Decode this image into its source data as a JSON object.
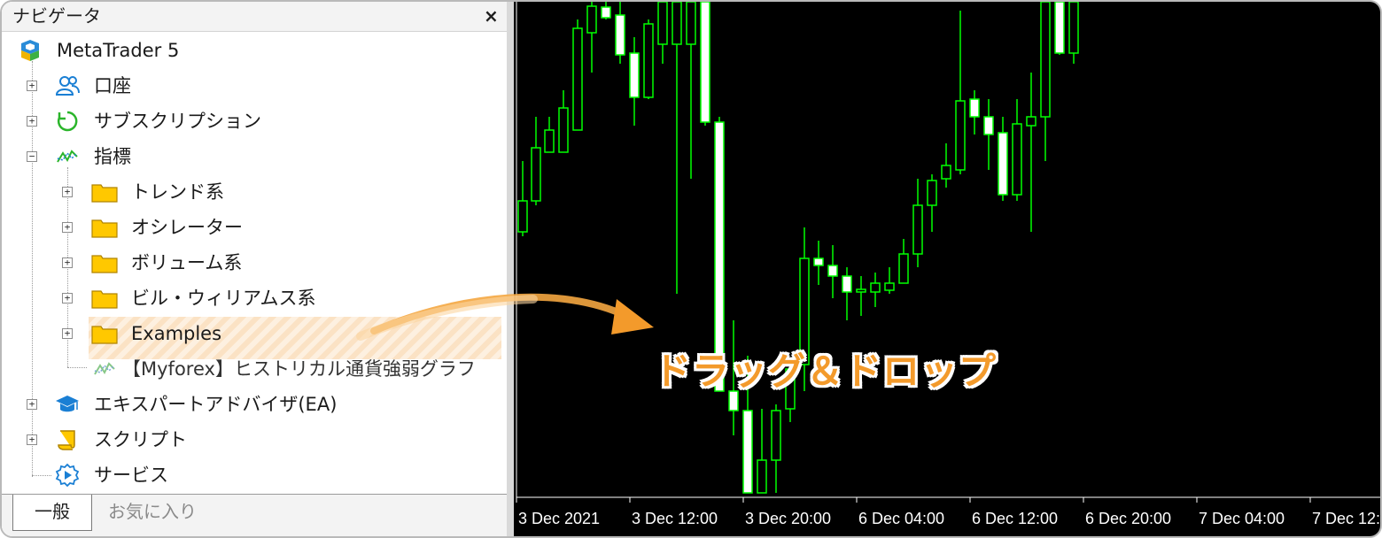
{
  "navigator": {
    "title": "ナビゲータ",
    "close_label": "×",
    "root": {
      "label": "MetaTrader 5",
      "icon": "metatrader-logo-icon"
    },
    "items": [
      {
        "label": "口座",
        "icon": "account-icon",
        "expander": "+"
      },
      {
        "label": "サブスクリプション",
        "icon": "subscription-icon",
        "expander": "+"
      },
      {
        "label": "指標",
        "icon": "indicator-icon",
        "expander": "−"
      },
      {
        "label": "トレンド系",
        "icon": "folder-icon",
        "expander": "+"
      },
      {
        "label": "オシレーター",
        "icon": "folder-icon",
        "expander": "+"
      },
      {
        "label": "ボリューム系",
        "icon": "folder-icon",
        "expander": "+"
      },
      {
        "label": "ビル・ウィリアムス系",
        "icon": "folder-icon",
        "expander": "+"
      },
      {
        "label": "Examples",
        "icon": "folder-icon",
        "expander": "+"
      },
      {
        "label": "【Myforex】ヒストリカル通貨強弱グラフ",
        "icon": "custom-indicator-icon",
        "selected": true
      },
      {
        "label": "エキスパートアドバイザ(EA)",
        "icon": "expert-advisor-icon",
        "expander": "+"
      },
      {
        "label": "スクリプト",
        "icon": "script-icon",
        "expander": "+"
      },
      {
        "label": "サービス",
        "icon": "service-icon"
      }
    ],
    "tabs": [
      {
        "label": "一般",
        "active": true
      },
      {
        "label": "お気に入り",
        "active": false
      }
    ]
  },
  "chart": {
    "background": "#000000",
    "candle_color": "#00ff00",
    "bull_fill": "#000000",
    "bear_fill": "#ffffff",
    "time_labels": [
      "3 Dec 2021",
      "3 Dec 12:00",
      "3 Dec 20:00",
      "6 Dec 04:00",
      "6 Dec 12:00",
      "6 Dec 20:00",
      "7 Dec 04:00",
      "7 Dec 12:00"
    ]
  },
  "callout": {
    "text": "ドラッグ＆ドロップ",
    "color": "#f39a2b"
  }
}
